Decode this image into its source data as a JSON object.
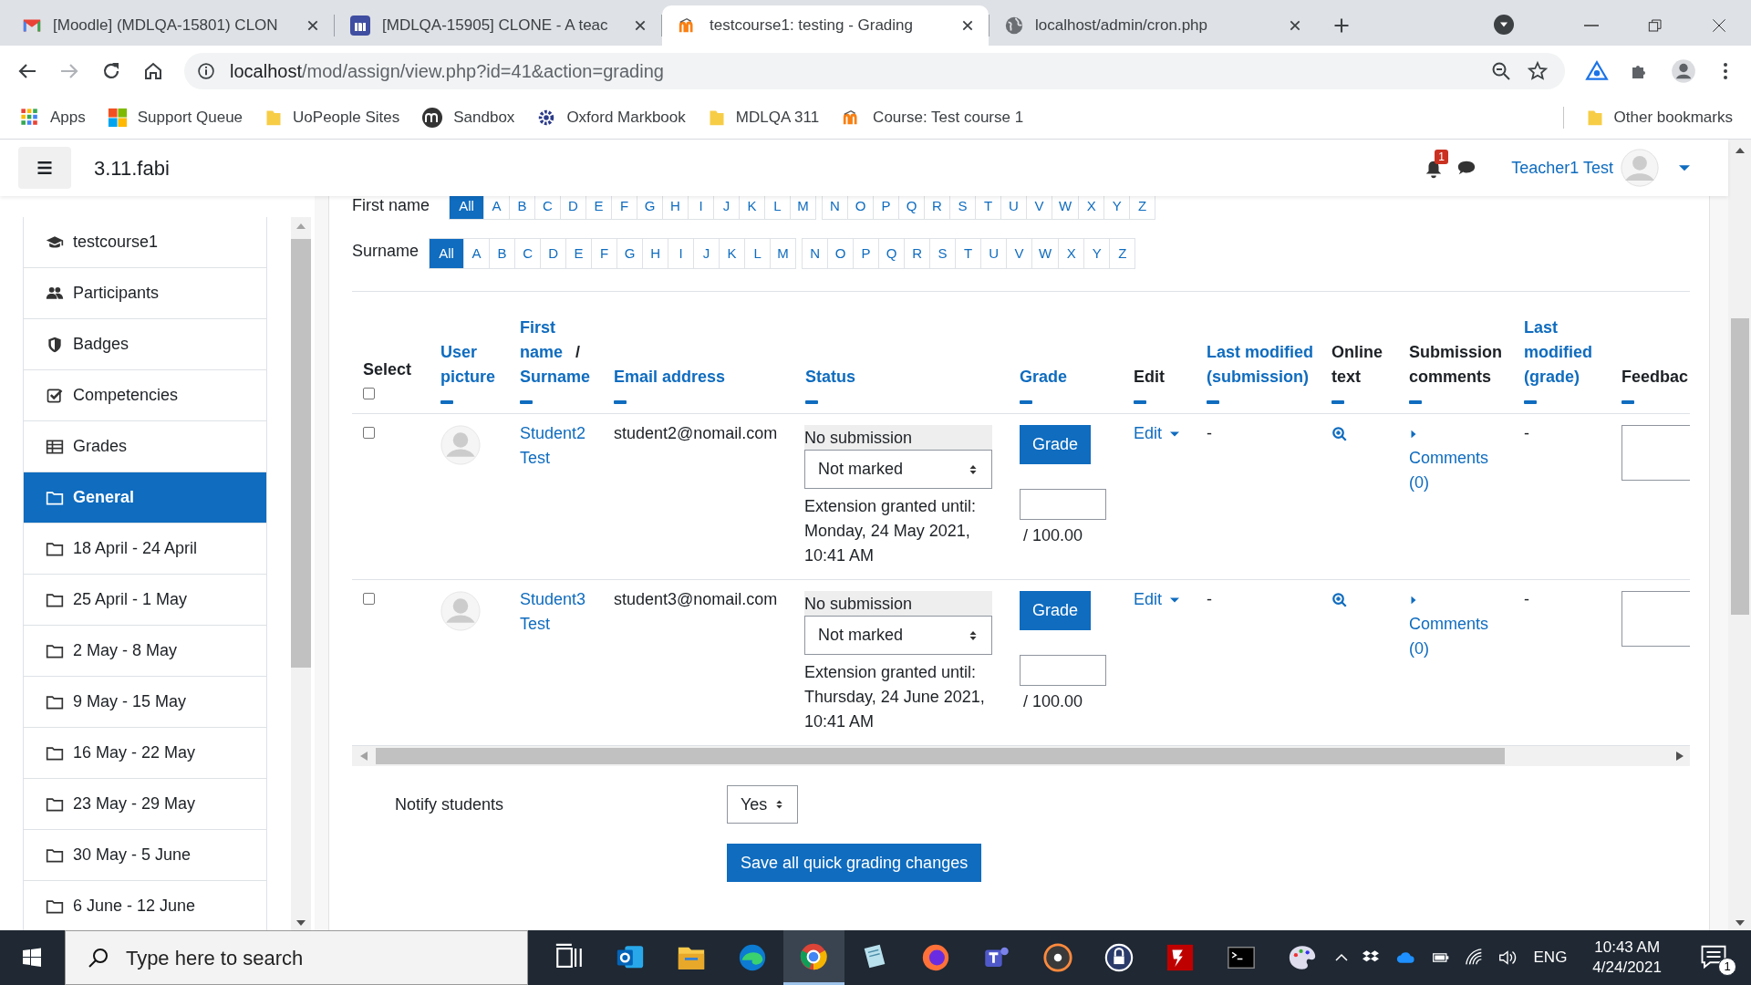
{
  "browser": {
    "tabs": [
      {
        "title": "[Moodle] (MDLQA-15801) CLON",
        "selected": false
      },
      {
        "title": "[MDLQA-15905] CLONE - A teac",
        "selected": false
      },
      {
        "title": "testcourse1: testing - Grading",
        "selected": true
      },
      {
        "title": "localhost/admin/cron.php",
        "selected": false
      }
    ],
    "address": {
      "host": "localhost",
      "path": "/mod/assign/view.php?id=41&action=grading"
    },
    "bookmarks": [
      {
        "label": "Apps"
      },
      {
        "label": "Support Queue"
      },
      {
        "label": "UoPeople Sites"
      },
      {
        "label": "Sandbox"
      },
      {
        "label": "Oxford Markbook"
      },
      {
        "label": "MDLQA 311"
      },
      {
        "label": "Course: Test course 1"
      }
    ],
    "other_bookmarks": "Other bookmarks"
  },
  "header": {
    "site_name": "3.11.fabi",
    "notification_count": "1",
    "user_name": "Teacher1 Test"
  },
  "sidebar": {
    "items": [
      {
        "label": "testcourse1",
        "kind": "course",
        "selected": false
      },
      {
        "label": "Participants",
        "kind": "users",
        "selected": false
      },
      {
        "label": "Badges",
        "kind": "badge",
        "selected": false
      },
      {
        "label": "Competencies",
        "kind": "check",
        "selected": false
      },
      {
        "label": "Grades",
        "kind": "table",
        "selected": false
      },
      {
        "label": "General",
        "kind": "folder",
        "selected": true
      },
      {
        "label": "18 April - 24 April",
        "kind": "folder",
        "selected": false
      },
      {
        "label": "25 April - 1 May",
        "kind": "folder",
        "selected": false
      },
      {
        "label": "2 May - 8 May",
        "kind": "folder",
        "selected": false
      },
      {
        "label": "9 May - 15 May",
        "kind": "folder",
        "selected": false
      },
      {
        "label": "16 May - 22 May",
        "kind": "folder",
        "selected": false
      },
      {
        "label": "23 May - 29 May",
        "kind": "folder",
        "selected": false
      },
      {
        "label": "30 May - 5 June",
        "kind": "folder",
        "selected": false
      },
      {
        "label": "6 June - 12 June",
        "kind": "folder",
        "selected": false
      }
    ]
  },
  "filters": [
    {
      "label": "First name",
      "letters": [
        {
          "label": "All",
          "selected": true
        },
        {
          "label": "A",
          "selected": false
        },
        {
          "label": "B",
          "selected": false
        },
        {
          "label": "C",
          "selected": false
        },
        {
          "label": "D",
          "selected": false
        },
        {
          "label": "E",
          "selected": false
        },
        {
          "label": "F",
          "selected": false
        },
        {
          "label": "G",
          "selected": false
        },
        {
          "label": "H",
          "selected": false
        },
        {
          "label": "I",
          "selected": false
        },
        {
          "label": "J",
          "selected": false
        },
        {
          "label": "K",
          "selected": false
        },
        {
          "label": "L",
          "selected": false
        },
        {
          "label": "M",
          "selected": false
        },
        {
          "label": "N",
          "selected": false
        },
        {
          "label": "O",
          "selected": false
        },
        {
          "label": "P",
          "selected": false
        },
        {
          "label": "Q",
          "selected": false
        },
        {
          "label": "R",
          "selected": false
        },
        {
          "label": "S",
          "selected": false
        },
        {
          "label": "T",
          "selected": false
        },
        {
          "label": "U",
          "selected": false
        },
        {
          "label": "V",
          "selected": false
        },
        {
          "label": "W",
          "selected": false
        },
        {
          "label": "X",
          "selected": false
        },
        {
          "label": "Y",
          "selected": false
        },
        {
          "label": "Z",
          "selected": false
        }
      ]
    },
    {
      "label": "Surname",
      "letters": [
        {
          "label": "All",
          "selected": true
        },
        {
          "label": "A",
          "selected": false
        },
        {
          "label": "B",
          "selected": false
        },
        {
          "label": "C",
          "selected": false
        },
        {
          "label": "D",
          "selected": false
        },
        {
          "label": "E",
          "selected": false
        },
        {
          "label": "F",
          "selected": false
        },
        {
          "label": "G",
          "selected": false
        },
        {
          "label": "H",
          "selected": false
        },
        {
          "label": "I",
          "selected": false
        },
        {
          "label": "J",
          "selected": false
        },
        {
          "label": "K",
          "selected": false
        },
        {
          "label": "L",
          "selected": false
        },
        {
          "label": "M",
          "selected": false
        },
        {
          "label": "N",
          "selected": false
        },
        {
          "label": "O",
          "selected": false
        },
        {
          "label": "P",
          "selected": false
        },
        {
          "label": "Q",
          "selected": false
        },
        {
          "label": "R",
          "selected": false
        },
        {
          "label": "S",
          "selected": false
        },
        {
          "label": "T",
          "selected": false
        },
        {
          "label": "U",
          "selected": false
        },
        {
          "label": "V",
          "selected": false
        },
        {
          "label": "W",
          "selected": false
        },
        {
          "label": "X",
          "selected": false
        },
        {
          "label": "Y",
          "selected": false
        },
        {
          "label": "Z",
          "selected": false
        }
      ]
    }
  ],
  "table": {
    "columns": [
      {
        "label": "Select",
        "kind": "select",
        "checked": false
      },
      {
        "label": "User picture",
        "kind": "link"
      },
      {
        "label": "First name",
        "separator": "/",
        "label_2": "Surname",
        "kind": "name"
      },
      {
        "label": "Email address",
        "kind": "link"
      },
      {
        "label": "Status",
        "kind": "link"
      },
      {
        "label": "Grade",
        "kind": "link"
      },
      {
        "label": "Edit",
        "kind": "plain"
      },
      {
        "label": "Last modified (submission)",
        "kind": "link"
      },
      {
        "label": "Online text",
        "kind": "plain"
      },
      {
        "label": "Submission comments",
        "kind": "plain"
      },
      {
        "label": "Last modified (grade)",
        "kind": "link"
      },
      {
        "label": "Feedbac",
        "kind": "plain"
      }
    ],
    "rows": [
      {
        "checked": false,
        "name": "Student2 Test",
        "email": "student2@nomail.com",
        "status": "No submission",
        "marking": "Not marked",
        "extension": "Extension granted until: Monday, 24 May 2021, 10:41 AM",
        "grade_button": "Grade",
        "grade_max": "/ 100.00",
        "edit": "Edit",
        "last_modified_submission": "-",
        "comments": "Comments (0)",
        "last_modified_grade": "-"
      },
      {
        "checked": false,
        "name": "Student3 Test",
        "email": "student3@nomail.com",
        "status": "No submission",
        "marking": "Not marked",
        "extension": "Extension granted until: Thursday, 24 June 2021, 10:41 AM",
        "grade_button": "Grade",
        "grade_max": "/ 100.00",
        "edit": "Edit",
        "last_modified_submission": "-",
        "comments": "Comments (0)",
        "last_modified_grade": "-"
      }
    ]
  },
  "notify": {
    "label": "Notify students",
    "value": "Yes"
  },
  "save_button": "Save all quick grading changes",
  "taskbar": {
    "search_placeholder": "Type here to search",
    "language": "ENG",
    "time": "10:43 AM",
    "date": "4/24/2021",
    "notification_count": "1"
  }
}
